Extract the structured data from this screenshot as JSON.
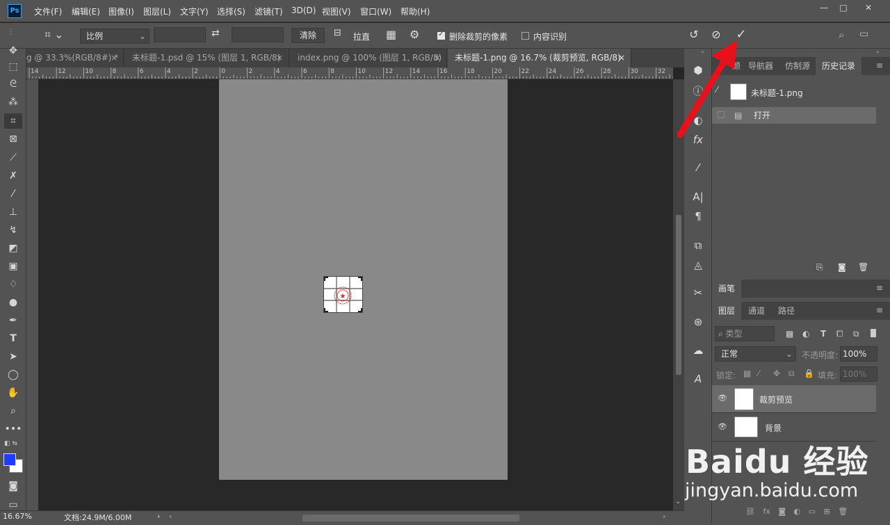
{
  "app": {
    "logo": "Ps"
  },
  "menubar": {
    "items": [
      "文件(F)",
      "编辑(E)",
      "图像(I)",
      "图层(L)",
      "文字(Y)",
      "选择(S)",
      "滤镜(T)",
      "3D(D)",
      "视图(V)",
      "窗口(W)",
      "帮助(H)"
    ],
    "window_controls": {
      "minimize": "—",
      "restore": "□",
      "close": "✕"
    }
  },
  "options": {
    "ratio_select": "比例",
    "ratio_w": "",
    "ratio_h": "",
    "swap_icon": "⇄",
    "clear_button": "清除",
    "straighten_label": "拉直",
    "delete_cropped_label": "删除裁剪的像素",
    "delete_cropped_checked": true,
    "content_aware_label": "内容识别",
    "content_aware_checked": false,
    "reset_icon": "↺",
    "cancel_icon": "⊘",
    "commit_icon": "✓"
  },
  "tabs": [
    {
      "label": "g @ 33.3%(RGB/8#) *",
      "close": "×",
      "active": false
    },
    {
      "label": "未标题-1.psd @ 15% (图层 1, RGB/8)",
      "close": "×",
      "active": false
    },
    {
      "label": "index.png @ 100% (图层 1, RGB/8)",
      "close": "×",
      "active": false
    },
    {
      "label": "未标题-1.png @ 16.7% (裁剪预览, RGB/8)",
      "close": "×",
      "active": true
    }
  ],
  "ruler": {
    "labels": [
      "14",
      "12",
      "10",
      "8",
      "6",
      "4",
      "2",
      "0",
      "2",
      "4",
      "6",
      "8",
      "10",
      "12",
      "14",
      "16",
      "18",
      "20",
      "22",
      "24",
      "26",
      "28",
      "30",
      "32"
    ]
  },
  "status": {
    "zoom": "16.67%",
    "doc": "文档:24.9M/6.00M"
  },
  "tools": [
    "move",
    "marquee",
    "lasso",
    "magic-wand",
    "crop",
    "frame",
    "eyedropper",
    "healing",
    "brush",
    "stamp",
    "history-brush",
    "eraser",
    "gradient",
    "blur",
    "dodge",
    "pen",
    "type",
    "path-select",
    "shape",
    "hand",
    "zoom",
    "more",
    "swap",
    "fg-bg",
    "quickmask",
    "screen-mode"
  ],
  "colors": {
    "foreground": "#1f3cff",
    "background": "#ffffff",
    "arrow": "#e8101a",
    "commit_accent": "#e6e6e6"
  },
  "history_panel": {
    "tabs": [
      "颜",
      "导航器",
      "仿制源",
      "历史记录"
    ],
    "active_tab": "历史记录",
    "snapshot_name": "未标题-1.png",
    "steps": [
      {
        "label": "打开",
        "selected": true
      }
    ]
  },
  "brush_panel": {
    "title": "画笔"
  },
  "layers_panel": {
    "tabs": [
      "图层",
      "通道",
      "路径"
    ],
    "filter_placeholder": "类型",
    "blend_mode": "正常",
    "opacity_label": "不透明度:",
    "opacity_value": "100%",
    "lock_label": "锁定:",
    "fill_label": "填充:",
    "fill_value": "100%",
    "layers": [
      {
        "name": "裁剪预览",
        "selected": true
      },
      {
        "name": "背景",
        "selected": false
      }
    ]
  },
  "watermark": {
    "brand": "Baidu 经验",
    "url": "jingyan.baidu.com"
  }
}
